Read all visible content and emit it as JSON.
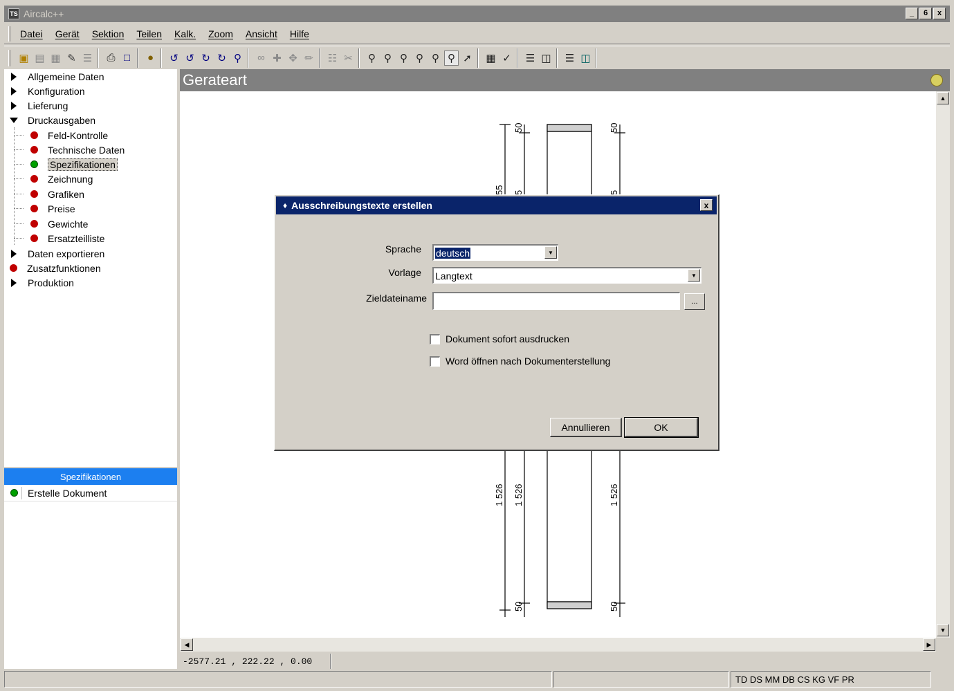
{
  "window": {
    "title": "Aircalc++",
    "icon_label": "TS",
    "controls": [
      "_",
      "6",
      "x"
    ]
  },
  "menu": [
    "Datei",
    "Gerät",
    "Sektion",
    "Teilen",
    "Kalk.",
    "Zoom",
    "Ansicht",
    "Hilfe"
  ],
  "toolbar_icons": [
    [
      "open-folder-icon",
      "save-icon",
      "save-all-icon",
      "edit-document-icon",
      "notes-icon"
    ],
    [
      "print-icon",
      "book-icon"
    ],
    [
      "lock-icon"
    ],
    [
      "rotate-left-icon",
      "rotate-ccw-icon",
      "rotate-cw-icon",
      "rotate-right-icon",
      "filter-icon"
    ],
    [
      "move-points-icon",
      "move-icon",
      "pan-icon",
      "pencil-icon"
    ],
    [
      "columns-icon",
      "cut-icon"
    ],
    [
      "zoom-window-icon",
      "zoom-out-icon",
      "zoom-all-icon",
      "zoom-in-icon",
      "zoom-prev-icon",
      "zoom-select-icon",
      "zoom-pick-icon"
    ],
    [
      "properties-icon",
      "measure-icon"
    ],
    [
      "layers-icon",
      "layers-copy-icon"
    ],
    [
      "layer-manager-icon",
      "layer-export-icon"
    ]
  ],
  "tree": {
    "items": [
      {
        "label": "Allgemeine Daten",
        "type": "collapsed"
      },
      {
        "label": "Konfiguration",
        "type": "collapsed"
      },
      {
        "label": "Lieferung",
        "type": "collapsed"
      },
      {
        "label": "Druckausgaben",
        "type": "expanded"
      },
      {
        "label": "Feld-Kontrolle",
        "type": "child-red"
      },
      {
        "label": "Technische Daten",
        "type": "child-red"
      },
      {
        "label": "Spezifikationen",
        "type": "child-green",
        "selected": true
      },
      {
        "label": "Zeichnung",
        "type": "child-red"
      },
      {
        "label": "Grafiken",
        "type": "child-red"
      },
      {
        "label": "Preise",
        "type": "child-red"
      },
      {
        "label": "Gewichte",
        "type": "child-red"
      },
      {
        "label": "Ersatzteilliste",
        "type": "child-red"
      },
      {
        "label": "Daten exportieren",
        "type": "collapsed"
      },
      {
        "label": "Zusatzfunktionen",
        "type": "top-red"
      },
      {
        "label": "Produktion",
        "type": "collapsed"
      }
    ]
  },
  "lower_panel": {
    "header": "Spezifikationen",
    "rows": [
      "Erstelle Dokument"
    ]
  },
  "canvas": {
    "header": "Gerateart",
    "dimensions": {
      "top_left": "50",
      "top_right": "50",
      "mid_left_a": "55",
      "mid_left_b": "5",
      "mid_right": "5",
      "lower_left_a": "1 526",
      "lower_left_b": "1 526",
      "lower_right": "1 526",
      "bottom_left": "50",
      "bottom_right": "50"
    }
  },
  "coordinates": "-2577.21 , 222.22 , 0.00",
  "status": {
    "right": "TD DS MM DB CS KG VF PR"
  },
  "dialog": {
    "title": "Ausschreibungstexte erstellen",
    "close": "x",
    "fields": {
      "sprache_label": "Sprache",
      "sprache_value": "deutsch",
      "vorlage_label": "Vorlage",
      "vorlage_value": "Langtext",
      "zieldatei_label": "Zieldateiname",
      "zieldatei_value": "",
      "browse_label": "..."
    },
    "checkboxes": [
      {
        "label": "Dokument sofort ausdrucken",
        "checked": false
      },
      {
        "label": "Word öffnen nach Dokumenterstellung",
        "checked": false
      }
    ],
    "buttons": {
      "cancel": "Annullieren",
      "ok": "OK"
    }
  }
}
